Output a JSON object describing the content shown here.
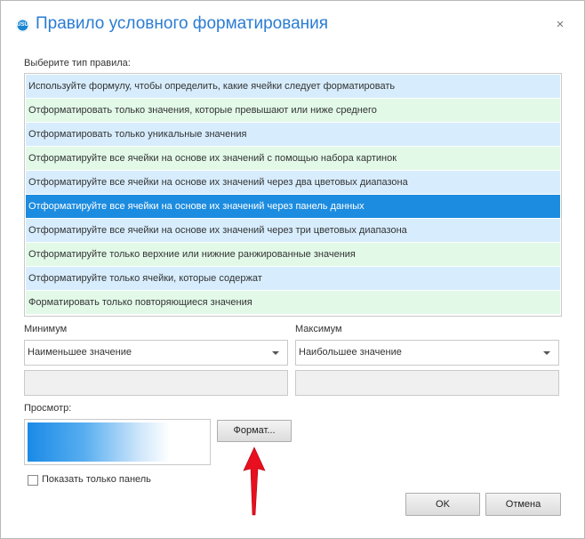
{
  "window": {
    "title": "Правило условного форматирования",
    "app_icon": "usu-logo-icon",
    "close_glyph": "×"
  },
  "rule_type": {
    "label": "Выберите тип правила:",
    "selected_index": 5,
    "items": [
      {
        "label": "Используйте формулу, чтобы определить, какие ячейки следует форматировать",
        "tint": "blue"
      },
      {
        "label": "Отформатировать только значения, которые превышают или ниже среднего",
        "tint": "green"
      },
      {
        "label": "Отформатировать только уникальные значения",
        "tint": "blue"
      },
      {
        "label": "Отформатируйте все ячейки на основе их значений с помощью набора картинок",
        "tint": "green"
      },
      {
        "label": "Отформатируйте все ячейки на основе их значений через два цветовых диапазона",
        "tint": "blue"
      },
      {
        "label": "Отформатируйте все ячейки на основе их значений через панель данных",
        "tint": "selected"
      },
      {
        "label": "Отформатируйте все ячейки на основе их значений через три цветовых диапазона",
        "tint": "blue"
      },
      {
        "label": "Отформатируйте только верхние или нижние ранжированные значения",
        "tint": "green"
      },
      {
        "label": "Отформатируйте только ячейки, которые содержат",
        "tint": "blue"
      },
      {
        "label": "Форматировать только повторяющиеся значения",
        "tint": "green"
      }
    ]
  },
  "minimum": {
    "label": "Минимум",
    "type_value": "Наименьшее значение",
    "value": ""
  },
  "maximum": {
    "label": "Максимум",
    "type_value": "Наибольшее значение",
    "value": ""
  },
  "preview": {
    "label": "Просмотр:",
    "format_button": "Формат...",
    "bar_color_start": "#1a8ae6",
    "bar_color_end": "#ffffff"
  },
  "show_bar_only": {
    "label": "Показать только панель",
    "checked": false
  },
  "footer": {
    "ok_label": "OK",
    "cancel_label": "Отмена"
  },
  "colors": {
    "title": "#2a7cd3",
    "row_blue": "#d7edfd",
    "row_green": "#e2f9e8",
    "row_selected": "#1c8ce0",
    "annotation_arrow": "#e8101e"
  }
}
